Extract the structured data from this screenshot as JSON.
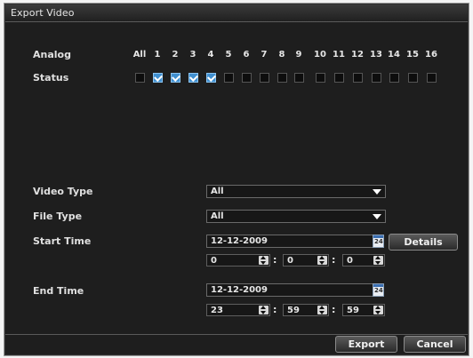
{
  "window": {
    "title": "Export Video"
  },
  "channels": {
    "analog_label": "Analog",
    "status_label": "Status",
    "items": [
      {
        "label": "All",
        "checked": false
      },
      {
        "label": "1",
        "checked": true
      },
      {
        "label": "2",
        "checked": true
      },
      {
        "label": "3",
        "checked": true
      },
      {
        "label": "4",
        "checked": true
      },
      {
        "label": "5",
        "checked": false
      },
      {
        "label": "6",
        "checked": false
      },
      {
        "label": "7",
        "checked": false
      },
      {
        "label": "8",
        "checked": false
      },
      {
        "label": "9",
        "checked": false
      },
      {
        "label": "10",
        "checked": false
      },
      {
        "label": "11",
        "checked": false
      },
      {
        "label": "12",
        "checked": false
      },
      {
        "label": "13",
        "checked": false
      },
      {
        "label": "14",
        "checked": false
      },
      {
        "label": "15",
        "checked": false
      },
      {
        "label": "16",
        "checked": false
      }
    ]
  },
  "form": {
    "video_type": {
      "label": "Video Type",
      "value": "All"
    },
    "file_type": {
      "label": "File Type",
      "value": "All"
    },
    "start_time": {
      "label": "Start Time",
      "date": "12-12-2009",
      "hour": "0",
      "minute": "0",
      "second": "0"
    },
    "end_time": {
      "label": "End Time",
      "date": "12-12-2009",
      "hour": "23",
      "minute": "59",
      "second": "59"
    },
    "calendar_icon_text": "24"
  },
  "buttons": {
    "details": "Details",
    "export": "Export",
    "cancel": "Cancel"
  }
}
